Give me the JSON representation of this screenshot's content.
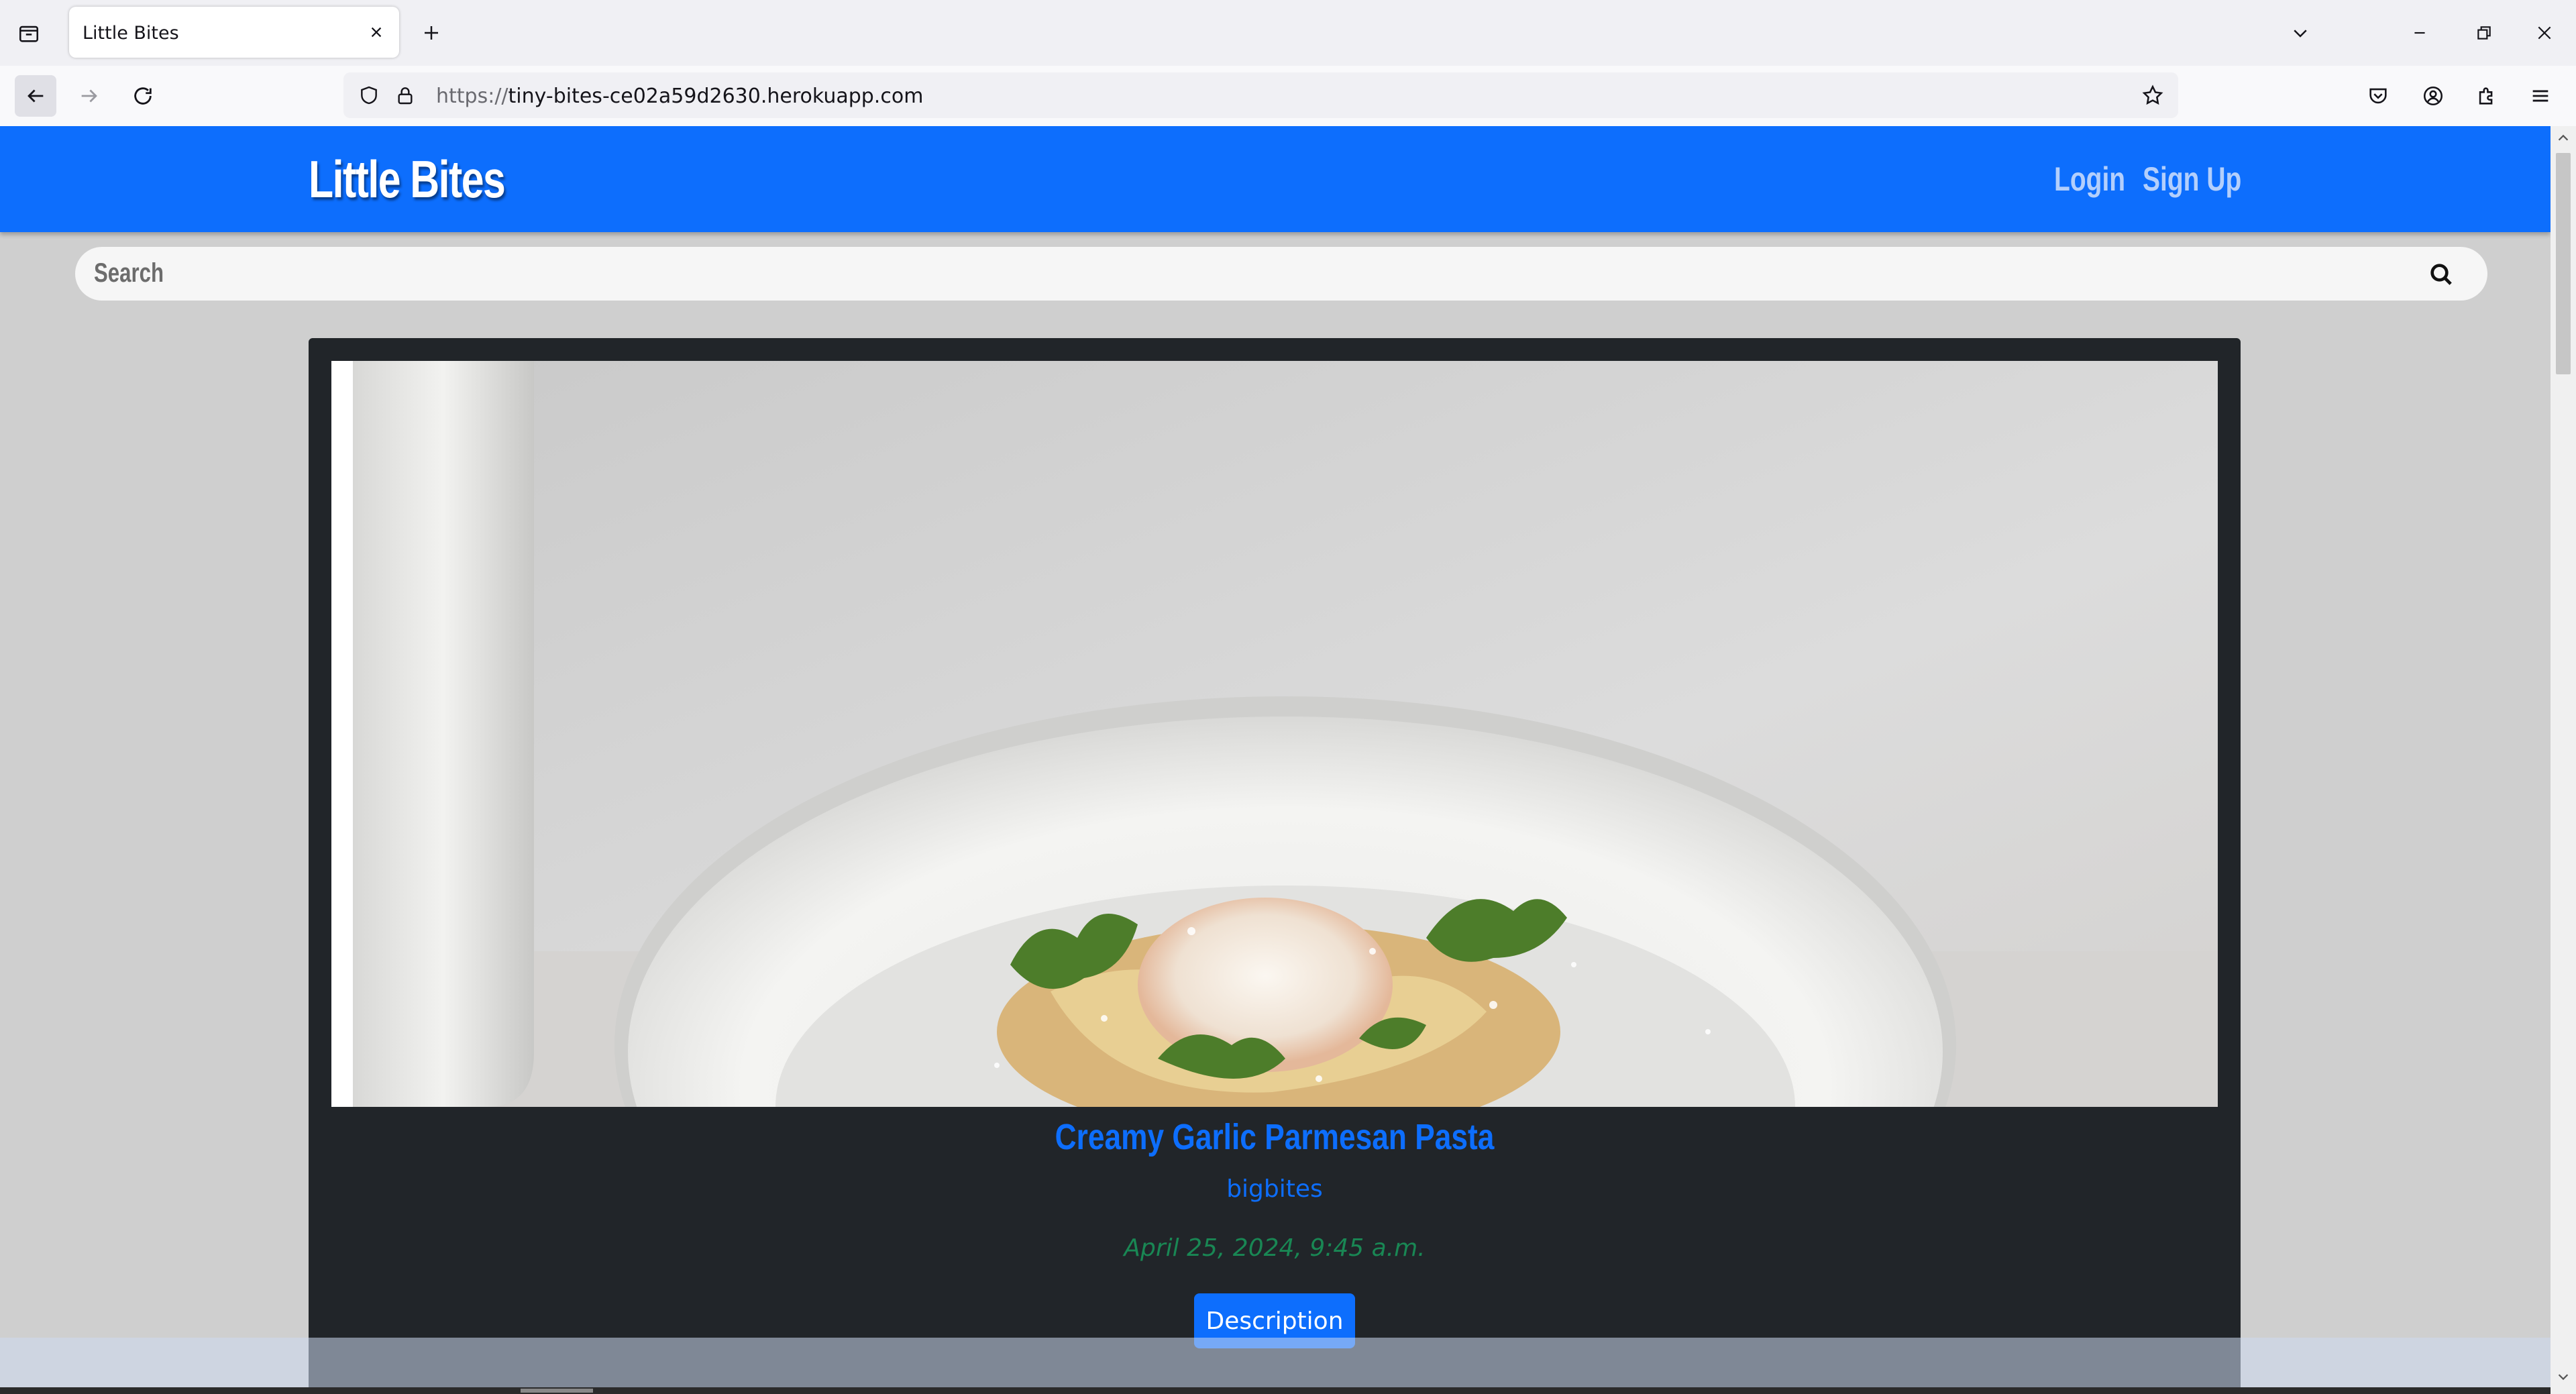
{
  "browser": {
    "tab": {
      "title": "Little Bites"
    },
    "url": {
      "scheme": "https://",
      "host": "tiny-bites-ce02a59d2630.herokuapp.com"
    },
    "icons": {
      "list_all_tabs": "tab-list-icon",
      "close_tab": "close-icon",
      "new_tab": "plus-icon",
      "list_tabs_dropdown": "chevron-down-icon",
      "minimize": "minimize-icon",
      "restore": "restore-icon",
      "close_window": "close-icon",
      "back": "back-arrow-icon",
      "forward": "forward-arrow-icon",
      "reload": "reload-icon",
      "tracking_protection": "shield-icon",
      "secure": "lock-icon",
      "bookmark": "star-icon",
      "pocket": "pocket-icon",
      "account": "account-icon",
      "extensions": "puzzle-icon",
      "menu": "hamburger-menu-icon"
    }
  },
  "site": {
    "brand": "Little Bites",
    "nav": {
      "login": "Login",
      "signup": "Sign Up"
    },
    "search": {
      "placeholder": "Search",
      "icon": "search-icon"
    },
    "colors": {
      "primary": "#0d6efd",
      "card_bg": "#212529",
      "date_green": "#198754"
    }
  },
  "recipe": {
    "title": "Creamy Garlic Parmesan Pasta",
    "author": "bigbites",
    "date": "April 25, 2024, 9:45 a.m.",
    "button": "Description"
  }
}
